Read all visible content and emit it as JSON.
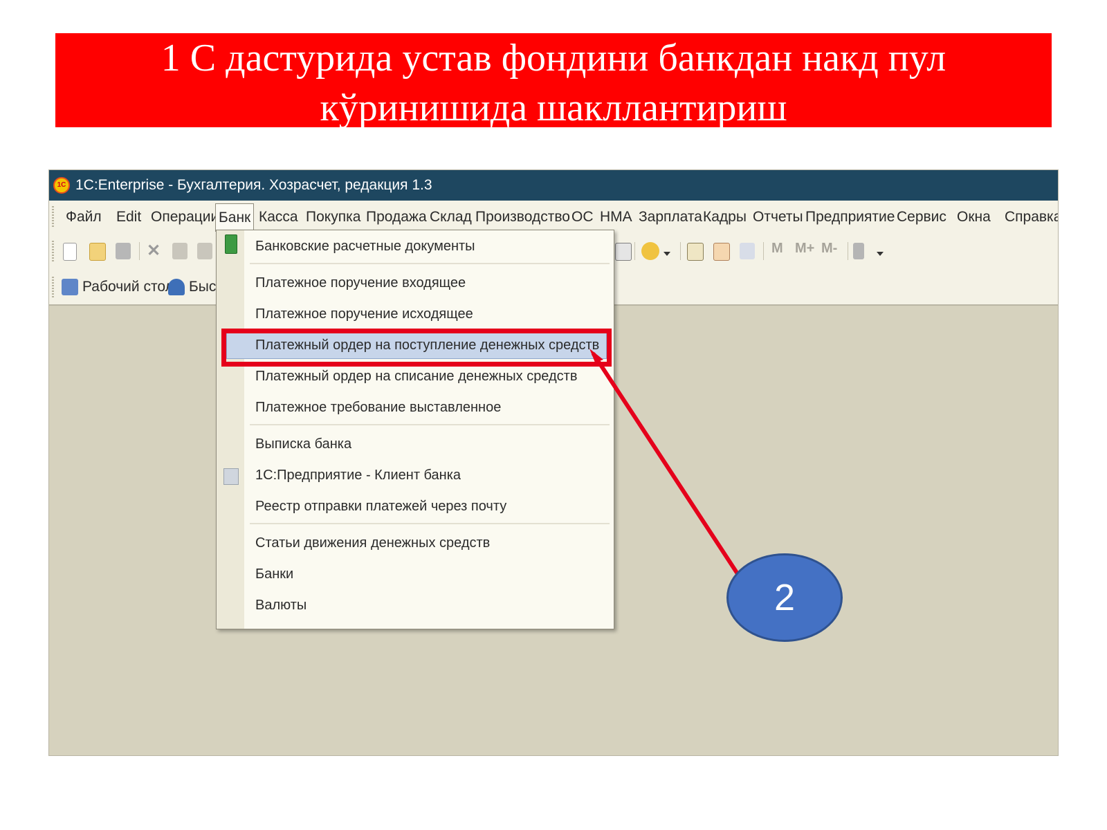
{
  "slide": {
    "title_line1": "1 С дастурида устав фондини банкдан накд пул",
    "title_line2": "кўринишида шакллантириш"
  },
  "window": {
    "title": "1С:Enterprise - Бухгалтерия. Хозрасчет, редакция 1.3",
    "logo_text": "1С"
  },
  "menubar": {
    "items": [
      "Файл",
      "Edit",
      "Операции",
      "Банк",
      "Касса",
      "Покупка",
      "Продажа",
      "Склад",
      "Производство",
      "ОС",
      "НМА",
      "Зарплата",
      "Кадры",
      "Отчеты",
      "Предприятие",
      "Сервис",
      "Окна",
      "Справка"
    ],
    "active": "Банк"
  },
  "toolbar": {
    "m_buttons": [
      "M",
      "M+",
      "M-"
    ]
  },
  "panel": {
    "desktop_label": "Рабочий стол",
    "quick_label": "Быс"
  },
  "bank_menu": {
    "items": [
      "Банковские расчетные документы",
      "Платежное поручение входящее",
      "Платежное поручение исходящее",
      "Платежный ордер на поступление денежных средств",
      "Платежный ордер на списание денежных средств",
      "Платежное требование выставленное",
      "Выписка банка",
      "1С:Предприятие - Клиент банка",
      "Реестр отправки платежей через почту",
      "Статьи движения денежных средств",
      "Банки",
      "Валюты"
    ],
    "highlighted": "Платежный ордер на поступление денежных средств"
  },
  "callout": {
    "label": "2",
    "color": "#4471c4",
    "arrow_color": "#e5001b"
  },
  "colors": {
    "slide_title_bg": "#ff0000",
    "titlebar_bg": "#1e4760",
    "workspace_bg": "#d6d2be"
  }
}
